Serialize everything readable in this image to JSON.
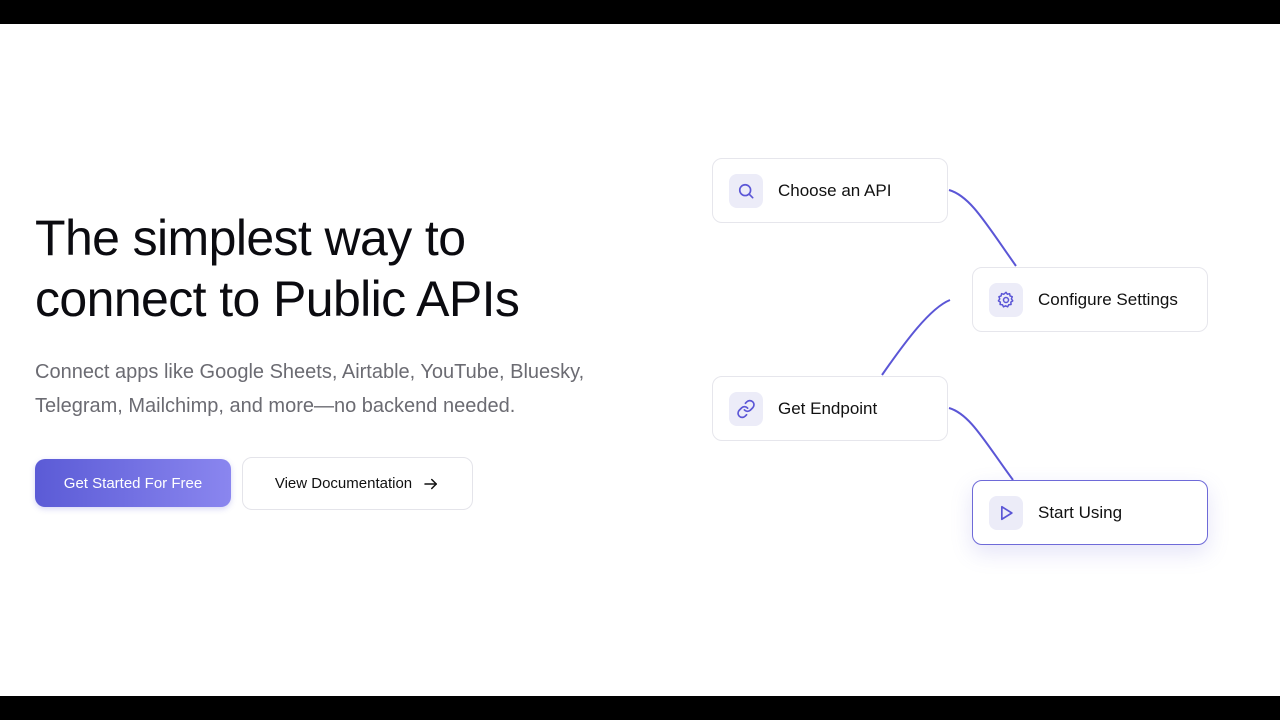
{
  "hero": {
    "title_line1": "The simplest way to",
    "title_line2": "connect to Public APIs",
    "subtitle_line1": "Connect apps like Google Sheets, Airtable, YouTube, Bluesky,",
    "subtitle_line2": "Telegram, Mailchimp, and more—no backend needed."
  },
  "buttons": {
    "primary_label": "Get Started For Free",
    "secondary_label": "View Documentation",
    "secondary_icon": "arrow-right-icon"
  },
  "steps": [
    {
      "label": "Choose an API",
      "icon": "search-icon",
      "active": false
    },
    {
      "label": "Configure Settings",
      "icon": "gear-icon",
      "active": false
    },
    {
      "label": "Get Endpoint",
      "icon": "link-icon",
      "active": false
    },
    {
      "label": "Start Using",
      "icon": "play-icon",
      "active": true
    }
  ],
  "colors": {
    "accent": "#5b5bd6",
    "accent_light": "#8a86ef",
    "connector": "#5b56d6",
    "icon_bg": "#ececf8"
  }
}
